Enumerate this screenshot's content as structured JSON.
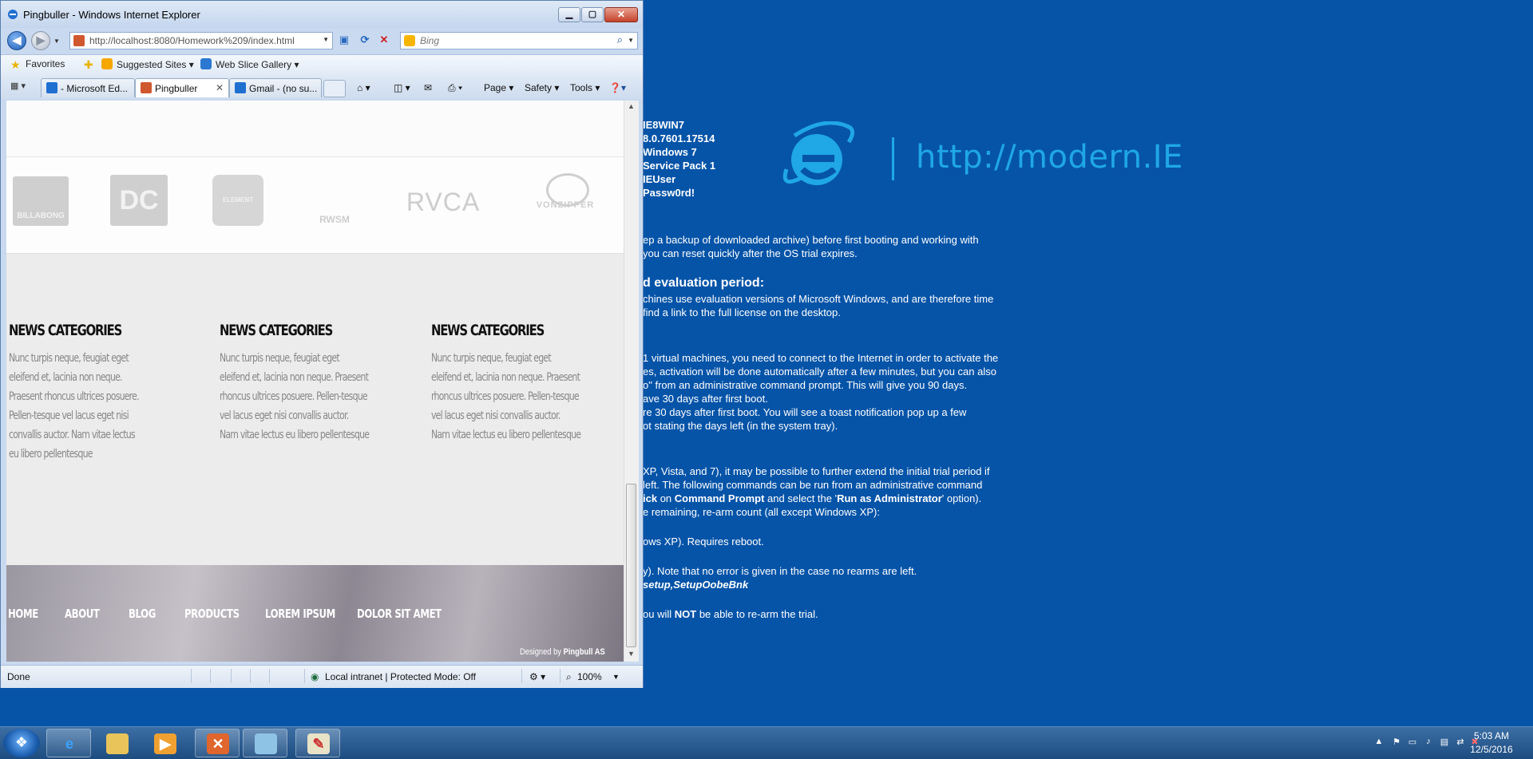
{
  "desktop": {
    "info_lines": [
      "IE8WIN7",
      "8.0.7601.17514",
      "Windows 7",
      "Service Pack 1",
      "IEUser",
      "Passw0rd!"
    ],
    "logo_url": "http://modern.IE",
    "text": {
      "p1a": "ep a backup of downloaded archive) before first booting and working with",
      "p1b": "you can reset quickly after the OS trial expires.",
      "h2": "d evaluation period:",
      "p2a": "chines use evaluation versions of Microsoft Windows, and are therefore time",
      "p2b": "find a link to the full license on the desktop.",
      "p3a": "1 virtual machines, you need to connect to the Internet in order to activate the",
      "p3b": "es, activation will be done automatically after a few minutes, but you can also",
      "p3c_pre": "o\" from an administrative command prompt. This will give you 90 days.",
      "p3d": "ave 30 days after first boot.",
      "p3e": "re 30 days after first boot. You will see a toast notification pop up a few",
      "p3f": "ot stating the days left (in the system tray).",
      "p4a": "XP, Vista, and 7), it may be possible to further extend the initial trial period if",
      "p4b": "left. The following commands can be run from an administrative command",
      "p4c_b1": "ick",
      "p4c_t1": " on ",
      "p4c_b2": "Command Prompt",
      "p4c_t2": " and select the '",
      "p4c_b3": "Run as Administrator",
      "p4c_t3": "' option).",
      "p4d": "e remaining, re-arm count (all except Windows XP):",
      "p5": "ows XP). Requires reboot.",
      "p6": "y). Note that no error is given in the case no rearms are left.",
      "p7": "setup,SetupOobeBnk",
      "p8_pre": "ou will ",
      "p8_b": "NOT",
      "p8_post": " be able to re-arm the trial."
    }
  },
  "window": {
    "title": "Pingbuller - Windows Internet Explorer",
    "min_glyph": "▁",
    "max_glyph": "▢",
    "close_glyph": "✕"
  },
  "nav": {
    "back_glyph": "◀",
    "fwd_glyph": "▶",
    "address": "http://localhost:8080/Homework%209/index.html",
    "search_placeholder": "Bing"
  },
  "favorites_bar": {
    "favorites": "Favorites",
    "suggested": "Suggested Sites ▾",
    "webslice": "Web Slice Gallery ▾"
  },
  "tabs": [
    {
      "label": "- Microsoft Ed...",
      "icon_color": "#1f6fd1"
    },
    {
      "label": "Pingbuller",
      "icon_color": "#d0582e"
    },
    {
      "label": "Gmail - (no su...",
      "icon_color": "#1f6fd1"
    }
  ],
  "commands": {
    "page": "Page ▾",
    "safety": "Safety ▾",
    "tools": "Tools ▾",
    "help": "❓▾"
  },
  "page": {
    "brands": [
      "BILLABONG",
      "DC",
      "ELEMENT",
      "RWSM",
      "RVCA",
      "VONZIPPER"
    ],
    "news": [
      {
        "title": "NEWS CATEGORIES",
        "text": "Nunc turpis neque, feugiat eget eleifend et, lacinia non neque. Praesent rhoncus ultrices posuere. Pellen-tesque vel lacus eget nisi convallis auctor. Nam vitae lectus eu libero pellentesque"
      },
      {
        "title": "NEWS CATEGORIES",
        "text": "Nunc turpis neque, feugiat eget eleifend et, lacinia non neque. Praesent rhoncus ultrices posuere. Pellen-tesque vel lacus eget nisi convallis auctor. Nam vitae lectus eu libero pellentesque"
      },
      {
        "title": "NEWS CATEGORIES",
        "text": "Nunc turpis neque, feugiat eget eleifend et, lacinia non neque. Praesent rhoncus ultrices posuere. Pellen-tesque vel lacus eget nisi convallis auctor. Nam vitae lectus eu libero pellentesque"
      }
    ],
    "footer_links": [
      "HOME",
      "ABOUT",
      "BLOG",
      "PRODUCTS",
      "LOREM IPSUM",
      "DOLOR SIT AMET"
    ],
    "designed_by": "Designed by",
    "designer": "Pingbull AS"
  },
  "status": {
    "done": "Done",
    "zone": "Local intranet | Protected Mode: Off",
    "zoom": "100%"
  },
  "taskbar": {
    "time": "5:03 AM",
    "date": "12/5/2016"
  },
  "colors": {
    "desktop_bg": "#0654a8",
    "ie_logo": "#1fa7e6",
    "xampp": "#d0582e"
  }
}
